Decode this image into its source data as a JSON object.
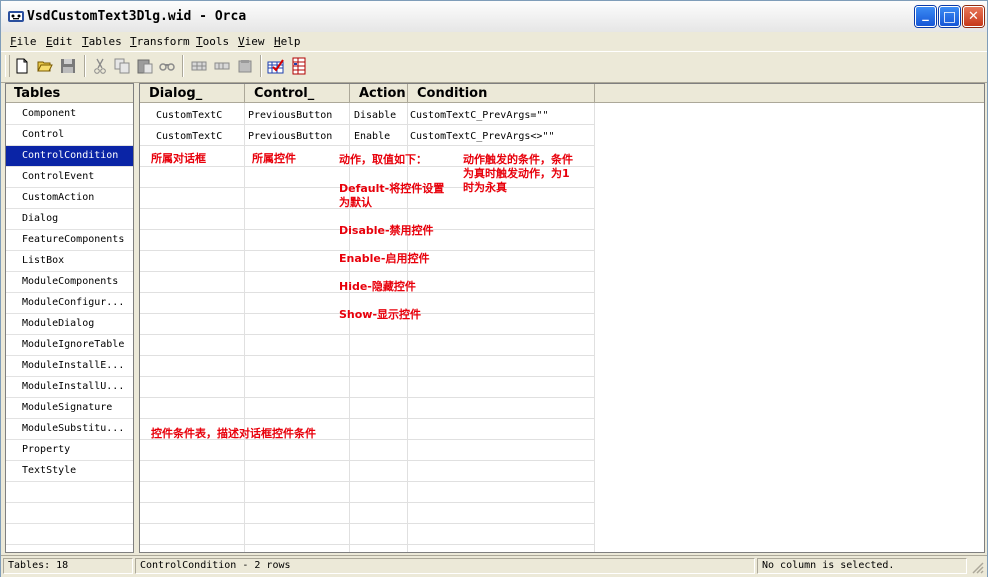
{
  "window": {
    "title": "VsdCustomText3Dlg.wid - Orca",
    "min_symbol": "_",
    "max_symbol": "□",
    "close_symbol": "✕"
  },
  "menu": [
    {
      "accel": "F",
      "rest": "ile"
    },
    {
      "accel": "E",
      "rest": "dit"
    },
    {
      "accel": "T",
      "rest": "ables"
    },
    {
      "accel": "T",
      "rest": "ransform"
    },
    {
      "accel": "T",
      "rest": "ools"
    },
    {
      "accel": "V",
      "rest": "iew"
    },
    {
      "accel": "H",
      "rest": "elp"
    }
  ],
  "toolbar_icons": [
    "new-icon",
    "open-icon",
    "save-icon",
    "cut-icon",
    "copy-icon",
    "paste-icon",
    "find-icon",
    "add-row-icon",
    "add-table-icon",
    "drop-table-icon",
    "validate-icon",
    "merge-module-icon"
  ],
  "tables_panel": {
    "header": "Tables",
    "items": [
      "Component",
      "Control",
      "ControlCondition",
      "ControlEvent",
      "CustomAction",
      "Dialog",
      "FeatureComponents",
      "ListBox",
      "ModuleComponents",
      "ModuleConfigur...",
      "ModuleDialog",
      "ModuleIgnoreTable",
      "ModuleInstallE...",
      "ModuleInstallU...",
      "ModuleSignature",
      "ModuleSubstitu...",
      "Property",
      "TextStyle"
    ],
    "selected": "ControlCondition"
  },
  "grid": {
    "columns": [
      "Dialog_",
      "Control_",
      "Action",
      "Condition"
    ],
    "rows": [
      [
        "CustomTextC",
        "PreviousButton",
        "Disable",
        "CustomTextC_PrevArgs=\"\""
      ],
      [
        "CustomTextC",
        "PreviousButton",
        "Enable",
        "CustomTextC_PrevArgs<>\"\""
      ]
    ]
  },
  "annotations": {
    "dialog_note": "所属对话框",
    "control_note": "所属控件",
    "action_title": "动作，取值如下：",
    "action_default_line1": "Default-将控件设置",
    "action_default_line2": "为默认",
    "action_disable": "Disable-禁用控件",
    "action_enable": "Enable-启用控件",
    "action_hide": "Hide-隐藏控件",
    "action_show": "Show-显示控件",
    "condition_line1": "动作触发的条件，条件",
    "condition_line2": "为真时触发动作，为1",
    "condition_line3": "时为永真",
    "table_note": "控件条件表，描述对话框控件条件"
  },
  "status": {
    "tables_count": "Tables: 18",
    "table_info": "ControlCondition - 2 rows",
    "column_info": "No column is selected."
  },
  "colors": {
    "selection": "#0a24a6",
    "annotation": "#e8000b",
    "chrome": "#ece9d8"
  }
}
